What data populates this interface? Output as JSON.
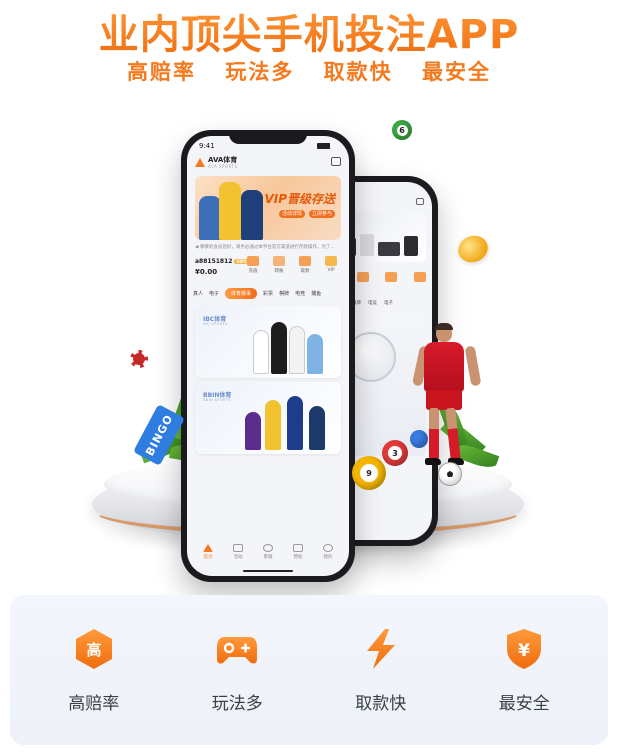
{
  "headline": "业内顶尖手机投注APP",
  "subline": [
    "高赔率",
    "玩法多",
    "取款快",
    "最安全"
  ],
  "colors": {
    "accent": "#f47a1f",
    "accent_dark": "#ef6d10",
    "panel_bg": "#f1f4fa",
    "label_text": "#3a3f4a"
  },
  "phone_front": {
    "time": "9:41",
    "brand": "AVA体育",
    "brand_sub": "AVA SPORTS",
    "hero_title": "VIP晋级存送",
    "hero_pills": [
      "活动详情",
      "立即参与"
    ],
    "notice": "◀ 尊敬的会员您好，请务必通过本平台官方渠道进行存款操作，为了…",
    "account_id": "a88151812",
    "vip_tag": "VIP1",
    "balance": "¥0.00",
    "quick_actions": [
      "充值",
      "转账",
      "取款",
      "VIP"
    ],
    "categories": [
      "真人",
      "电子",
      "体育赛事",
      "彩票",
      "棋牌",
      "电竞",
      "捕鱼"
    ],
    "active_category": "体育赛事",
    "cards": [
      {
        "name": "IBC体育",
        "sub": "IBC SPORTS"
      },
      {
        "name": "BBIN体育",
        "sub": "BBIN SPORTS"
      }
    ],
    "tabs": [
      {
        "label": "首页",
        "icon": "home-icon",
        "active": true
      },
      {
        "label": "活动",
        "icon": "gift-icon",
        "active": false
      },
      {
        "label": "客服",
        "icon": "headset-icon",
        "active": false
      },
      {
        "label": "赞助",
        "icon": "trophy-icon",
        "active": false
      },
      {
        "label": "我的",
        "icon": "user-icon",
        "active": false
      }
    ]
  },
  "phone_back": {
    "categories": [
      "电子",
      "棋牌",
      "电竞",
      "电子"
    ],
    "active_category": "电子"
  },
  "decorations": {
    "balls": [
      "6",
      "9",
      "3"
    ],
    "bingo_label": "BINGO"
  },
  "features": [
    {
      "label": "高赔率",
      "icon": "high-odds-icon",
      "glyph": "高"
    },
    {
      "label": "玩法多",
      "icon": "gamepad-icon",
      "glyph": ""
    },
    {
      "label": "取款快",
      "icon": "lightning-icon",
      "glyph": ""
    },
    {
      "label": "最安全",
      "icon": "shield-yen-icon",
      "glyph": "¥"
    }
  ]
}
